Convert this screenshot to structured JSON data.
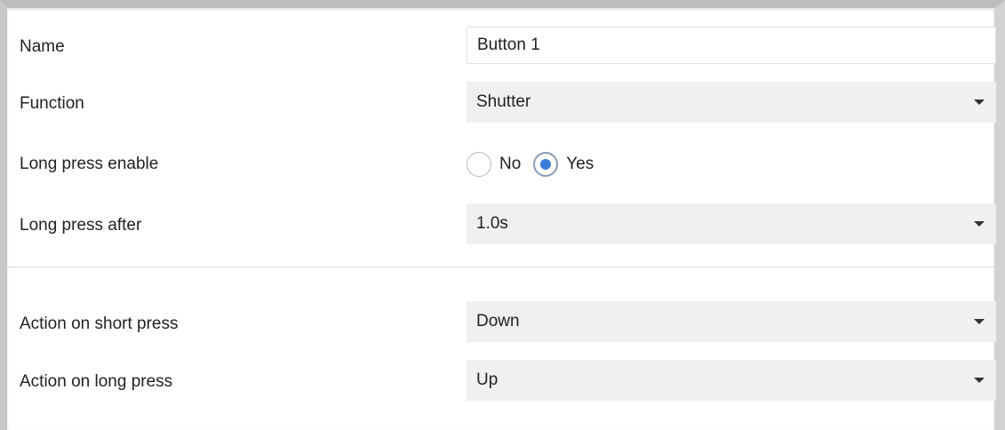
{
  "form": {
    "name": {
      "label": "Name",
      "value": "Button 1"
    },
    "function": {
      "label": "Function",
      "value": "Shutter"
    },
    "long_press_enable": {
      "label": "Long press enable",
      "options": [
        "No",
        "Yes"
      ],
      "selected": "Yes"
    },
    "long_press_after": {
      "label": "Long press after",
      "value": "1.0s"
    },
    "action_short": {
      "label": "Action on short press",
      "value": "Down"
    },
    "action_long": {
      "label": "Action on long press",
      "value": "Up"
    }
  },
  "icons": {
    "dropdown": "chevron-down-icon",
    "radio": "radio-button-icon"
  },
  "colors": {
    "select_background": "#f0f0f0",
    "radio_selected": "#3d7bd9",
    "text": "#222222",
    "divider": "#d8d8d8"
  }
}
